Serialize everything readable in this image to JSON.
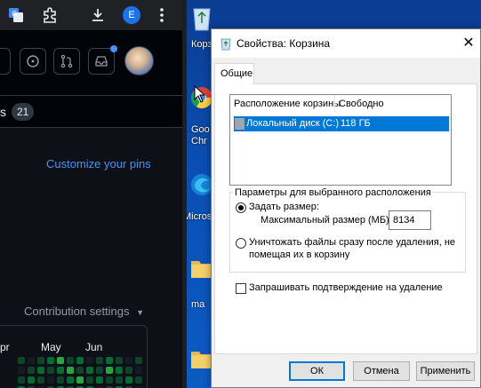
{
  "browser": {
    "profile_letter": "E"
  },
  "github": {
    "tab_partial": "s",
    "tab_count": "21",
    "customize_pins": "Customize your pins",
    "contribution_settings": "Contribution settings",
    "months": [
      "pr",
      "May",
      "Jun"
    ],
    "green_dark": "#0e4429",
    "green_mid": "#006d32",
    "green_light": "#26a641",
    "empty": "#161b22"
  },
  "desktop": {
    "labels": [
      "Корз",
      "Goo",
      "Chr",
      "Microsc",
      "ma"
    ]
  },
  "dialog": {
    "title": "Свойства: Корзина",
    "close": "✕",
    "tab": "Общие",
    "list": {
      "col_location": "Расположение корзины",
      "col_free": "Свободно",
      "row_location": "Локальный диск (C:)",
      "row_free": "118 ГБ"
    },
    "group_label": "Параметры для выбранного расположения",
    "option_custom": "Задать размер:",
    "max_size_label": "Максимальный размер (МБ):",
    "max_size_value": "8134",
    "option_delete_line1": "Уничтожать файлы сразу после удаления, не",
    "option_delete_line2": "помещая их в корзину",
    "confirm_delete": "Запрашивать подтверждение на удаление",
    "buttons": {
      "ok": "ОК",
      "cancel": "Отмена",
      "apply": "Применить"
    },
    "accent": "#0078d7"
  }
}
